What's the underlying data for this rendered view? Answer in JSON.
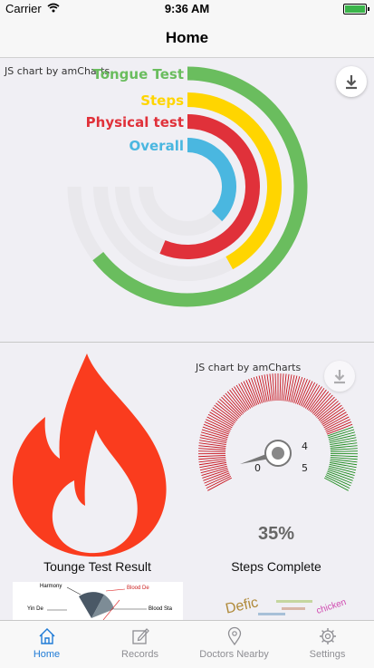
{
  "status_bar": {
    "carrier": "Carrier",
    "time": "9:36 AM"
  },
  "nav": {
    "title": "Home"
  },
  "radial_chart": {
    "credit": "JS chart by amCharts",
    "download_icon": "download-icon"
  },
  "chart_data": [
    {
      "type": "radial-bar",
      "categories": [
        "Tongue Test",
        "Steps",
        "Physical test",
        "Overall"
      ],
      "series": [
        {
          "values": [
            86,
            56,
            75,
            50
          ],
          "colors": [
            "#6abd5e",
            "#ffd500",
            "#e0313a",
            "#4ab7e0"
          ]
        }
      ],
      "ylim": [
        0,
        100
      ]
    },
    {
      "type": "gauge",
      "ticks": [
        "0",
        "4",
        "5"
      ],
      "value": 35,
      "value_label": "35%"
    }
  ],
  "gauge_chart": {
    "credit": "JS chart by amCharts",
    "value_label": "35%",
    "download_icon": "download-icon"
  },
  "captions": {
    "tongue": "Tounge Test Result",
    "steps": "Steps Complete"
  },
  "thumbnails": {
    "tongue_labels": [
      "Harmony",
      "Blood De",
      "Yin De",
      "Blood Sta"
    ],
    "cloud_words": [
      "Defic",
      "chicken"
    ]
  },
  "tabs": [
    {
      "label": "Home",
      "icon": "home-icon",
      "active": true
    },
    {
      "label": "Records",
      "icon": "records-icon",
      "active": false
    },
    {
      "label": "Doctors Nearby",
      "icon": "location-pin-icon",
      "active": false
    },
    {
      "label": "Settings",
      "icon": "gear-icon",
      "active": false
    }
  ],
  "colors": {
    "accent": "#1f7bd6",
    "flame": "#fa3c1e",
    "gauge_red": "#c8141e",
    "gauge_green": "#1e8c1e"
  }
}
